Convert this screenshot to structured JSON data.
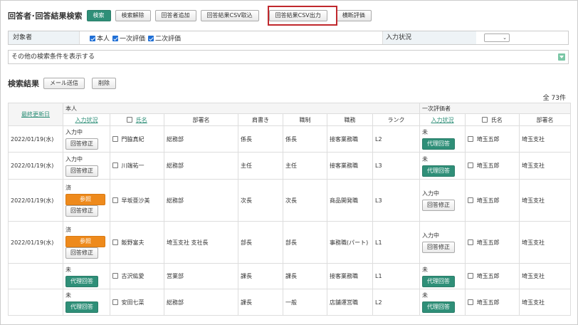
{
  "header": {
    "title": "回答者･回答結果検索",
    "buttons": [
      "検索",
      "検索解除",
      "回答者追加",
      "回答結果CSV取込",
      "回答結果CSV出力",
      "横断評価"
    ]
  },
  "filters": {
    "target_label": "対象者",
    "target_options": [
      "本人",
      "一次評価",
      "二次評価"
    ],
    "input_status_label": "入力状況",
    "input_status_value": "",
    "more_conditions": "その他の検索条件を表示する"
  },
  "results": {
    "title": "検索結果",
    "mail_button": "メール送信",
    "delete_button": "削除",
    "count": "全 73件"
  },
  "table": {
    "group_self": "本人",
    "group_first": "一次評価者",
    "col_updated": "最終更新日",
    "col_input_status": "入力状況",
    "col_name": "氏名",
    "col_dept": "部署名",
    "col_title": "肩書き",
    "col_position": "職制",
    "col_job": "職務",
    "col_rank": "ランク",
    "col_e_input_status": "入力状況",
    "col_e_name": "氏名",
    "col_e_dept": "部署名",
    "rows": [
      {
        "date": "2022/01/19(水)",
        "status": "入力中",
        "btns": [
          "回答修正"
        ],
        "name": "門脇真紀",
        "dept": "総務部",
        "title": "係長",
        "position": "係長",
        "job": "接客業務職",
        "rank": "L2",
        "e_status": "未",
        "e_btns": [
          "代理回答"
        ],
        "e_name": "埼玉五郎",
        "e_dept": "埼玉支社"
      },
      {
        "date": "2022/01/19(水)",
        "status": "入力中",
        "btns": [
          "回答修正"
        ],
        "name": "川端祐一",
        "dept": "総務部",
        "title": "主任",
        "position": "主任",
        "job": "接客業務職",
        "rank": "L3",
        "e_status": "未",
        "e_btns": [
          "代理回答"
        ],
        "e_name": "埼玉五郎",
        "e_dept": "埼玉支社"
      },
      {
        "date": "2022/01/19(水)",
        "status": "済",
        "btns": [
          "参照",
          "回答修正"
        ],
        "name": "早坂亜沙美",
        "dept": "総務部",
        "title": "次長",
        "position": "次長",
        "job": "商品開発職",
        "rank": "L3",
        "e_status": "入力中",
        "e_btns": [
          "回答修正"
        ],
        "e_name": "埼玉五郎",
        "e_dept": "埼玉支社"
      },
      {
        "date": "2022/01/19(水)",
        "status": "済",
        "btns": [
          "参照",
          "回答修正"
        ],
        "name": "飯野富夫",
        "dept": "埼玉支社 支社長",
        "title": "部長",
        "position": "部長",
        "job": "事務職(パート)",
        "rank": "L1",
        "e_status": "入力中",
        "e_btns": [
          "回答修正"
        ],
        "e_name": "埼玉五郎",
        "e_dept": "埼玉支社"
      },
      {
        "date": "",
        "status": "未",
        "btns": [
          "代理回答"
        ],
        "name": "古沢紘愛",
        "dept": "営業部",
        "title": "課長",
        "position": "課長",
        "job": "接客業務職",
        "rank": "L1",
        "e_status": "未",
        "e_btns": [
          "代理回答"
        ],
        "e_name": "埼玉五郎",
        "e_dept": "埼玉支社"
      },
      {
        "date": "",
        "status": "未",
        "btns": [
          "代理回答"
        ],
        "name": "安田七菜",
        "dept": "総務部",
        "title": "課長",
        "position": "一般",
        "job": "店舗運営職",
        "rank": "L2",
        "e_status": "未",
        "e_btns": [
          "代理回答"
        ],
        "e_name": "埼玉五郎",
        "e_dept": "埼玉支社"
      }
    ]
  }
}
